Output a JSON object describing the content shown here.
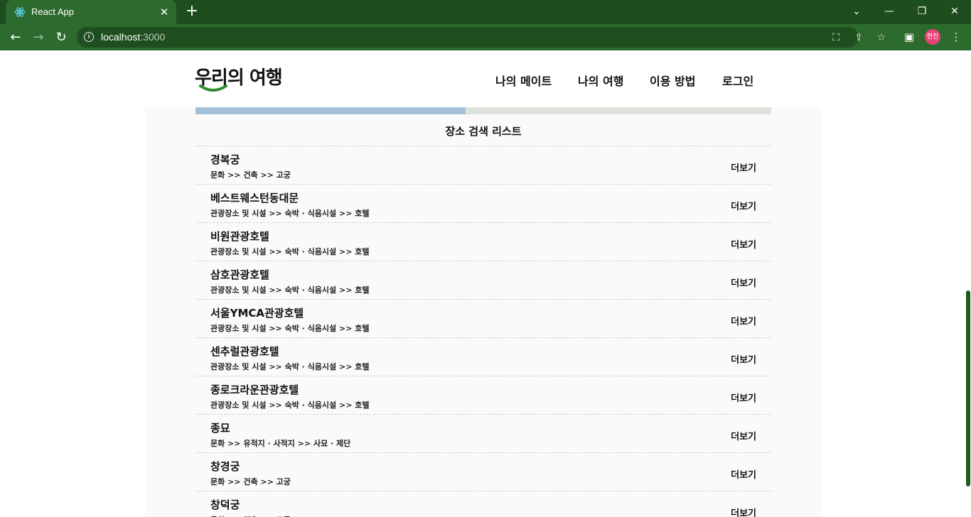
{
  "browser": {
    "tab_title": "React App",
    "url_host": "localhost",
    "url_port": ":3000",
    "profile_initials": "현진",
    "icons": [
      "react-favicon",
      "close-icon",
      "plus-icon",
      "back-icon",
      "forward-icon",
      "reload-icon",
      "info-icon",
      "translate-icon",
      "share-icon",
      "star-icon",
      "sidepanel-icon",
      "menu-icon"
    ]
  },
  "site": {
    "logo": {
      "part1": "우리의",
      "part2": "여행"
    },
    "nav": [
      "나의 메이트",
      "나의 여행",
      "이용 방법",
      "로그인"
    ]
  },
  "list": {
    "title": "장소 검색 리스트",
    "more_label": "더보기",
    "items": [
      {
        "name": "경복궁",
        "category": "문화 >> 건축 >> 고궁"
      },
      {
        "name": "베스트웨스턴동대문",
        "category": "관광장소 및 시설 >> 숙박 · 식음시설 >> 호텔"
      },
      {
        "name": "비원관광호텔",
        "category": "관광장소 및 시설 >> 숙박 · 식음시설 >> 호텔"
      },
      {
        "name": "삼호관광호텔",
        "category": "관광장소 및 시설 >> 숙박 · 식음시설 >> 호텔"
      },
      {
        "name": "서울YMCA관광호텔",
        "category": "관광장소 및 시설 >> 숙박 · 식음시설 >> 호텔"
      },
      {
        "name": "센추럴관광호텔",
        "category": "관광장소 및 시설 >> 숙박 · 식음시설 >> 호텔"
      },
      {
        "name": "종로크라운관광호텔",
        "category": "관광장소 및 시설 >> 숙박 · 식음시설 >> 호텔"
      },
      {
        "name": "종묘",
        "category": "문화 >> 유적지 · 사적지 >> 사묘 · 제단"
      },
      {
        "name": "창경궁",
        "category": "문화 >> 건축 >> 고궁"
      },
      {
        "name": "창덕궁",
        "category": "문화 >> 건축 >> 고궁"
      }
    ]
  },
  "colors": {
    "chrome": "#2d6a2d",
    "tabbar": "#1e4d1e",
    "accent": "#2e8b2e",
    "avatar": "#e8417a"
  }
}
